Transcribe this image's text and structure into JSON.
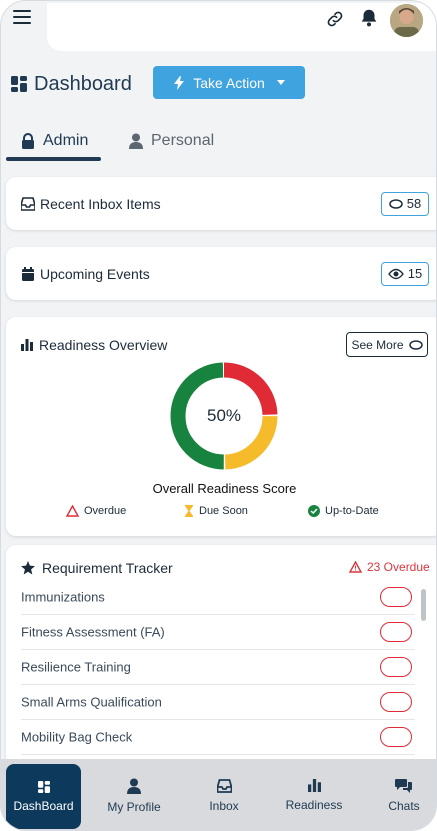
{
  "header": {
    "icons": [
      "menu-icon",
      "link-icon",
      "bell-icon",
      "avatar"
    ]
  },
  "dashboard": {
    "title": "Dashboard",
    "take_action_label": "Take Action"
  },
  "tabs": [
    {
      "label": "Admin",
      "active": true
    },
    {
      "label": "Personal",
      "active": false
    }
  ],
  "cards": {
    "inbox": {
      "label": "Recent Inbox Items",
      "count": "58"
    },
    "events": {
      "label": "Upcoming Events",
      "count": "15"
    }
  },
  "readiness": {
    "title": "Readiness Overview",
    "see_more_label": "See More",
    "percent_label": "50%",
    "score_title": "Overall Readiness Score",
    "segments": [
      {
        "name": "Overdue",
        "fraction": 0.25,
        "color": "#e02b36"
      },
      {
        "name": "Due Soon",
        "fraction": 0.25,
        "color": "#f5bb2b"
      },
      {
        "name": "Up-to-Date",
        "fraction": 0.5,
        "color": "#17833f"
      }
    ],
    "legend": [
      {
        "label": "Overdue",
        "color": "#e02b36",
        "icon": "triangle-warning-icon"
      },
      {
        "label": "Due Soon",
        "color": "#f5bb2b",
        "icon": "hourglass-icon"
      },
      {
        "label": "Up-to-Date",
        "color": "#17833f",
        "icon": "check-circle-icon"
      }
    ]
  },
  "tracker": {
    "title": "Requirement Tracker",
    "overdue_label": "23 Overdue",
    "items": [
      {
        "name": "Immunizations"
      },
      {
        "name": "Fitness Assessment (FA)"
      },
      {
        "name": "Resilience Training"
      },
      {
        "name": "Small Arms Qualification"
      },
      {
        "name": "Mobility Bag Check"
      }
    ]
  },
  "bottom_nav": [
    {
      "label": "DashBoard",
      "icon": "dashboard-icon",
      "active": true
    },
    {
      "label": "My Profile",
      "icon": "user-icon",
      "active": false
    },
    {
      "label": "Inbox",
      "icon": "inbox-icon",
      "active": false
    },
    {
      "label": "Readiness",
      "icon": "bar-chart-icon",
      "active": false
    },
    {
      "label": "Chats",
      "icon": "chat-icon",
      "active": false
    }
  ],
  "colors": {
    "primary": "#1f3a52",
    "accent": "#3fa3e0",
    "danger": "#e02b36",
    "warning": "#f5bb2b",
    "success": "#17833f",
    "nav_active": "#0d3a5c"
  }
}
